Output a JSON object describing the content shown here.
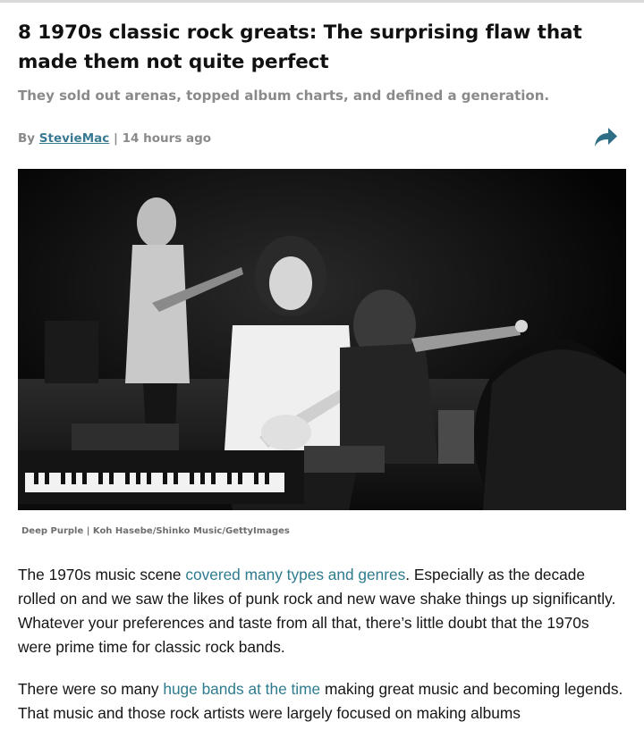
{
  "article": {
    "title": "8 1970s classic rock greats: The surprising flaw that made them not quite perfect",
    "subtitle": "They sold out arenas, topped album charts, and defined a generation.",
    "byline": {
      "prefix": "By ",
      "author": "StevieMac",
      "separator": " | ",
      "time": "14 hours ago"
    },
    "share_icon": "share-arrow-icon",
    "hero_caption": "Deep Purple | Koh Hasebe/Shinko Music/GettyImages",
    "paragraphs": [
      {
        "before": "The 1970s music scene ",
        "link": "covered many types and genres",
        "after": ". Especially as the decade rolled on and we saw the likes of punk rock and new wave shake things up significantly. Whatever your preferences and taste from all that, there’s little doubt that the 1970s were prime time for classic rock bands."
      },
      {
        "before": "There were so many ",
        "link": "huge bands at the time",
        "after": " making great music and becoming legends. That music and those rock artists were largely focused on making albums"
      }
    ]
  },
  "colors": {
    "link": "#2f7b8e",
    "author_link": "#3a7a92",
    "muted": "#8a8a8a",
    "share_icon": "#2f6f86"
  }
}
